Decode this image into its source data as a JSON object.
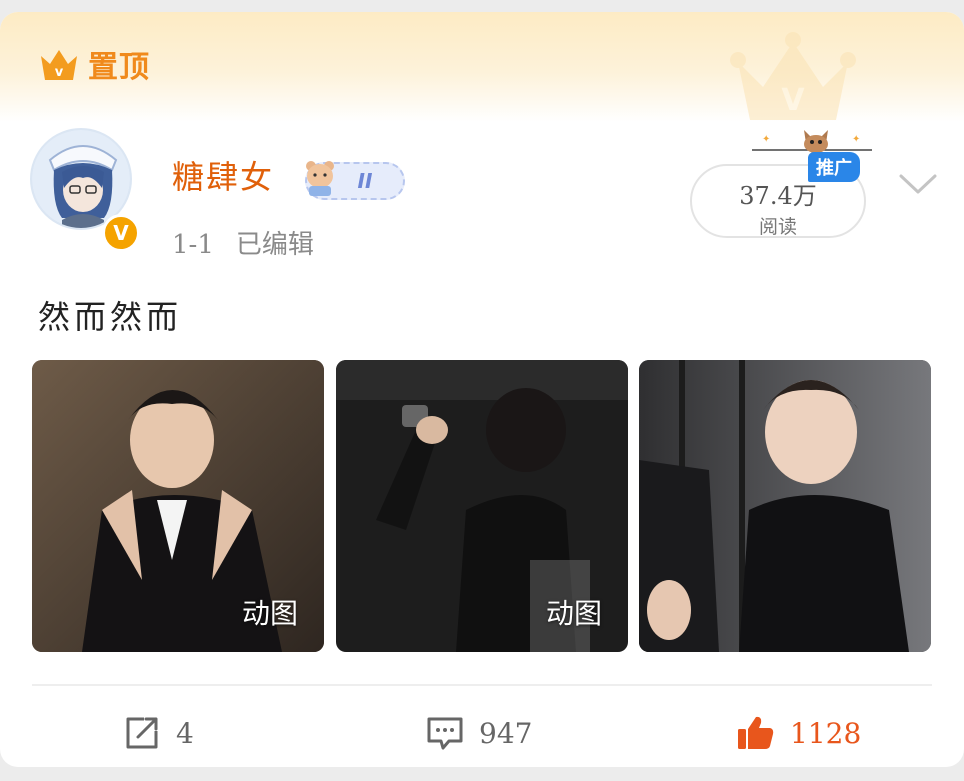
{
  "pinned": {
    "label": "置顶",
    "crown_color": "#f39c1f"
  },
  "author": {
    "name": "糖肆女",
    "level": "II",
    "verified_badge": "V",
    "time": "1-1",
    "edited": "已编辑"
  },
  "stats": {
    "reads_count": "37.4万",
    "reads_label": "阅读",
    "promo": "推广"
  },
  "post": {
    "text": "然而然而",
    "images": [
      {
        "tag": "动图"
      },
      {
        "tag": "动图"
      },
      {
        "tag": ""
      }
    ]
  },
  "actions": {
    "repost_count": "4",
    "comment_count": "947",
    "like_count": "1128"
  },
  "colors": {
    "accent_orange": "#e8561c",
    "username": "#e0600a",
    "promo_blue": "#2a86e8"
  },
  "icons": [
    "crown-icon",
    "verified-icon",
    "chevron-down-icon",
    "repost-icon",
    "comment-icon",
    "like-icon"
  ]
}
